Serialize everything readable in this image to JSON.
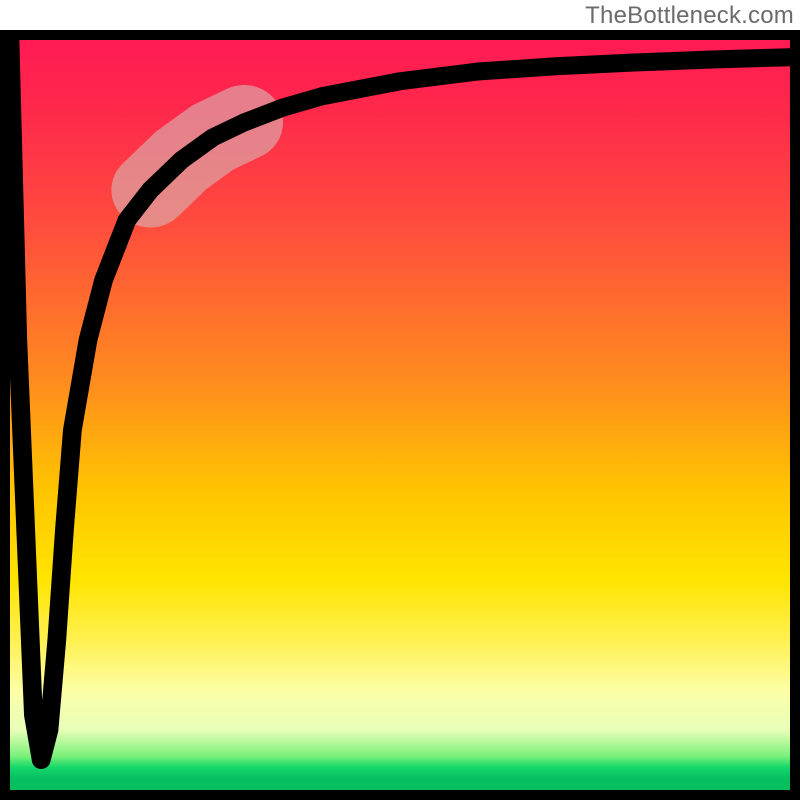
{
  "watermark": "TheBottleneck.com",
  "colors": {
    "frame": "#000000",
    "curve": "#000000",
    "highlight": "#d8adad",
    "gradient_top": "#ff1a54",
    "gradient_mid": "#ffc400",
    "gradient_bottom": "#06c060"
  },
  "chart_data": {
    "type": "line",
    "title": "",
    "xlabel": "",
    "ylabel": "",
    "xlim": [
      0,
      100
    ],
    "ylim": [
      0,
      100
    ],
    "grid": false,
    "legend": false,
    "series": [
      {
        "name": "bottleneck-curve",
        "x": [
          0,
          1,
          3,
          4,
          5,
          6,
          7,
          8,
          10,
          12,
          15,
          18,
          22,
          26,
          30,
          35,
          40,
          50,
          60,
          70,
          80,
          90,
          100
        ],
        "values": [
          100,
          60,
          10,
          4,
          8,
          20,
          35,
          48,
          60,
          68,
          76,
          80,
          84,
          87,
          89,
          91,
          92.5,
          94.5,
          95.8,
          96.5,
          97.0,
          97.4,
          97.7
        ]
      }
    ],
    "annotations": [
      {
        "name": "highlight-bump",
        "x_range": [
          18,
          30
        ],
        "note": "soft-rose stroke overlay on curve"
      }
    ],
    "background_gradient_stops": [
      {
        "pos": 0,
        "color": "#ff1a54"
      },
      {
        "pos": 0.25,
        "color": "#ff4d3d"
      },
      {
        "pos": 0.6,
        "color": "#ffc400"
      },
      {
        "pos": 0.8,
        "color": "#fcffa8"
      },
      {
        "pos": 0.95,
        "color": "#7af07a"
      },
      {
        "pos": 1.0,
        "color": "#06c060"
      }
    ]
  }
}
